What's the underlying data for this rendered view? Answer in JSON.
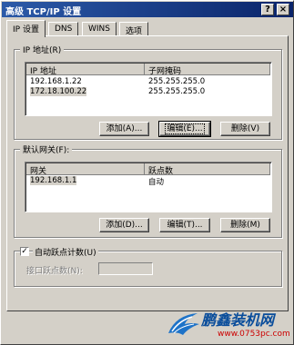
{
  "window": {
    "title": "高级 TCP/IP 设置",
    "help_btn": "?",
    "close_btn": "×"
  },
  "tabs": [
    {
      "label": "IP 设置"
    },
    {
      "label": "DNS"
    },
    {
      "label": "WINS"
    },
    {
      "label": "选项"
    }
  ],
  "ip_group": {
    "title": "IP 地址(R)",
    "headers": [
      "IP 地址",
      "子网掩码"
    ],
    "rows": [
      [
        "192.168.1.22",
        "255.255.255.0"
      ],
      [
        "172.18.100.22",
        "255.255.255.0"
      ]
    ],
    "buttons": {
      "add": "添加(A)...",
      "edit": "编辑(E)...",
      "delete": "删除(V)"
    }
  },
  "gw_group": {
    "title": "默认网关(F):",
    "headers": [
      "网关",
      "跃点数"
    ],
    "rows": [
      [
        "192.168.1.1",
        "自动"
      ]
    ],
    "buttons": {
      "add": "添加(D)...",
      "edit": "编辑(T)...",
      "delete": "删除(M)"
    }
  },
  "metric": {
    "auto_label": "自动跃点计数(U)",
    "auto_checked": "✓",
    "interface_label": "接口跃点数(N):",
    "interface_value": ""
  },
  "watermark": {
    "brand": "鹏鑫装机网",
    "url": "www.0753pc.com"
  }
}
